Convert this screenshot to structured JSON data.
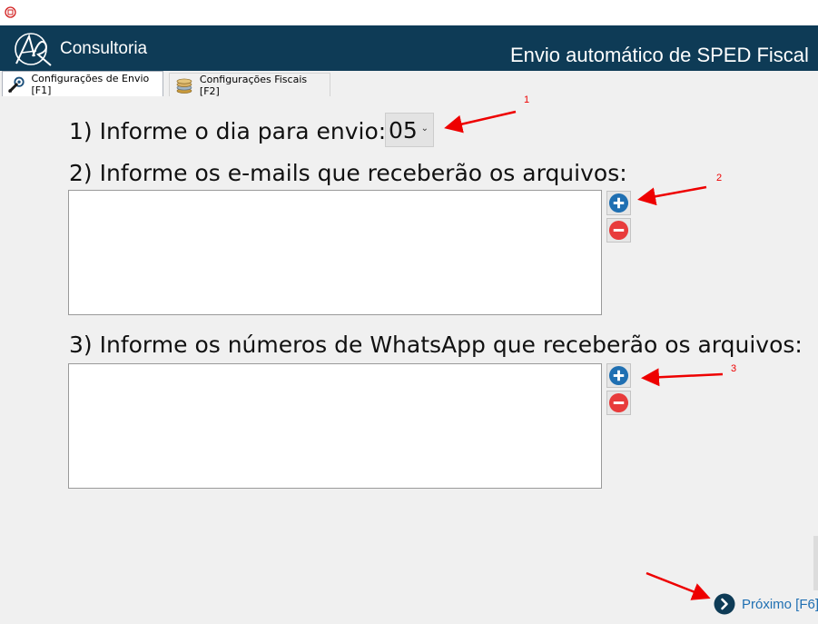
{
  "header": {
    "brand": "Consultoria",
    "title": "Envio automático de SPED Fiscal"
  },
  "tabs": [
    {
      "label": "Configurações de Envio [F1]",
      "icon": "wrench-gear-icon",
      "active": true
    },
    {
      "label": "Configurações Fiscais [F2]",
      "icon": "coins-icon",
      "active": false
    }
  ],
  "form": {
    "day_question": "1) Informe o dia para envio:",
    "day_value": "05",
    "emails_question": "2) Informe os e-mails que receberão os arquivos:",
    "whatsapp_question": "3) Informe os números de WhatsApp que receberão os arquivos:"
  },
  "annotations": [
    "1",
    "2",
    "3"
  ],
  "next_label": "Próximo [F6]",
  "colors": {
    "header_bg": "#0e3b56",
    "add_blue": "#1f6fb2",
    "remove_red": "#e83b3b",
    "annotation_red": "#ee0000",
    "link_blue": "#1f6fb2"
  }
}
